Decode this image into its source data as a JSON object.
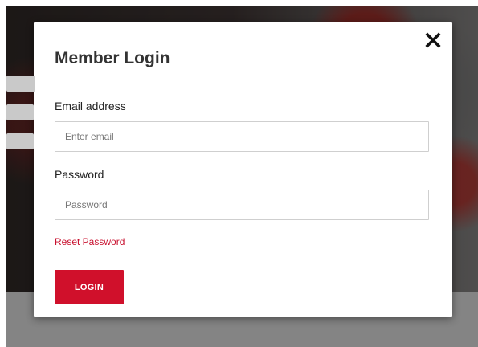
{
  "modal": {
    "title": "Member Login",
    "email": {
      "label": "Email address",
      "placeholder": "Enter email",
      "value": ""
    },
    "password": {
      "label": "Password",
      "placeholder": "Password",
      "value": ""
    },
    "reset_link": "Reset Password",
    "login_button": "LOGIN",
    "close_icon": "close-icon"
  },
  "colors": {
    "accent": "#d0102b",
    "link": "#c8102e",
    "title": "#333333",
    "overlay_below": "#848484"
  }
}
